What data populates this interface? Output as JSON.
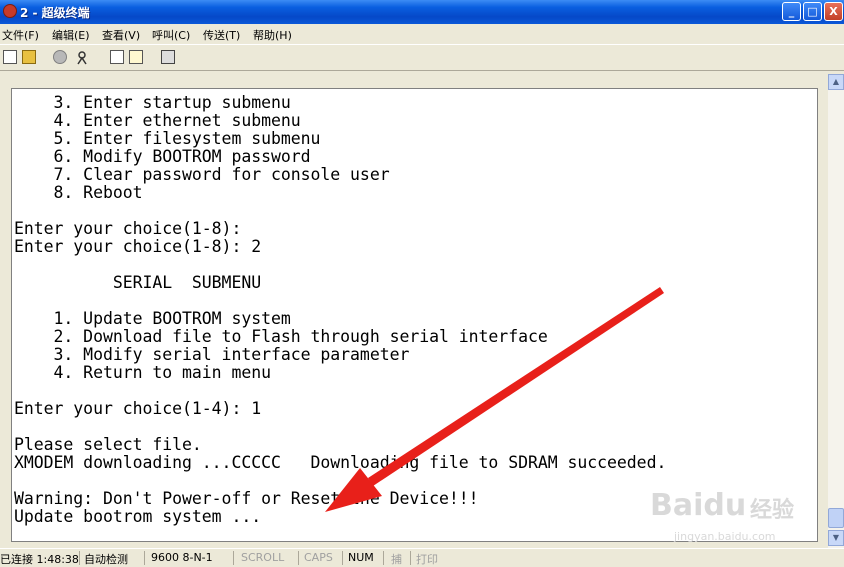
{
  "window": {
    "title": "2 - 超级终端"
  },
  "titlebar": {
    "minimize": "_",
    "maximize": "□",
    "close": "X"
  },
  "menu": [
    "文件(F)",
    "编辑(E)",
    "查看(V)",
    "呼叫(C)",
    "传送(T)",
    "帮助(H)"
  ],
  "terminal": {
    "lines": [
      "    3. Enter startup submenu",
      "    4. Enter ethernet submenu",
      "    5. Enter filesystem submenu",
      "    6. Modify BOOTROM password",
      "    7. Clear password for console user",
      "    8. Reboot",
      "",
      "Enter your choice(1-8):",
      "Enter your choice(1-8): 2",
      "",
      "          SERIAL  SUBMENU",
      "",
      "    1. Update BOOTROM system",
      "    2. Download file to Flash through serial interface",
      "    3. Modify serial interface parameter",
      "    4. Return to main menu",
      "",
      "Enter your choice(1-4): 1",
      "",
      "Please select file.",
      "XMODEM downloading ...CCCCC   Downloading file to SDRAM succeeded.",
      "",
      "Warning: Don't Power-off or Reset the Device!!!",
      "Update bootrom system ..."
    ]
  },
  "status": {
    "connected": "已连接 1:48:38",
    "detect": "自动检测",
    "params": "9600 8-N-1",
    "scroll": "SCROLL",
    "caps": "CAPS",
    "num": "NUM",
    "capture": "捕",
    "print": "打印"
  },
  "watermark": {
    "brand": "Baidu",
    "cn": "经验",
    "url": "jingyan.baidu.com"
  },
  "colors": {
    "arrow": "#E8201A",
    "titlebar": "#0A5FE0",
    "terminal_bg": "#FFFFFF"
  }
}
